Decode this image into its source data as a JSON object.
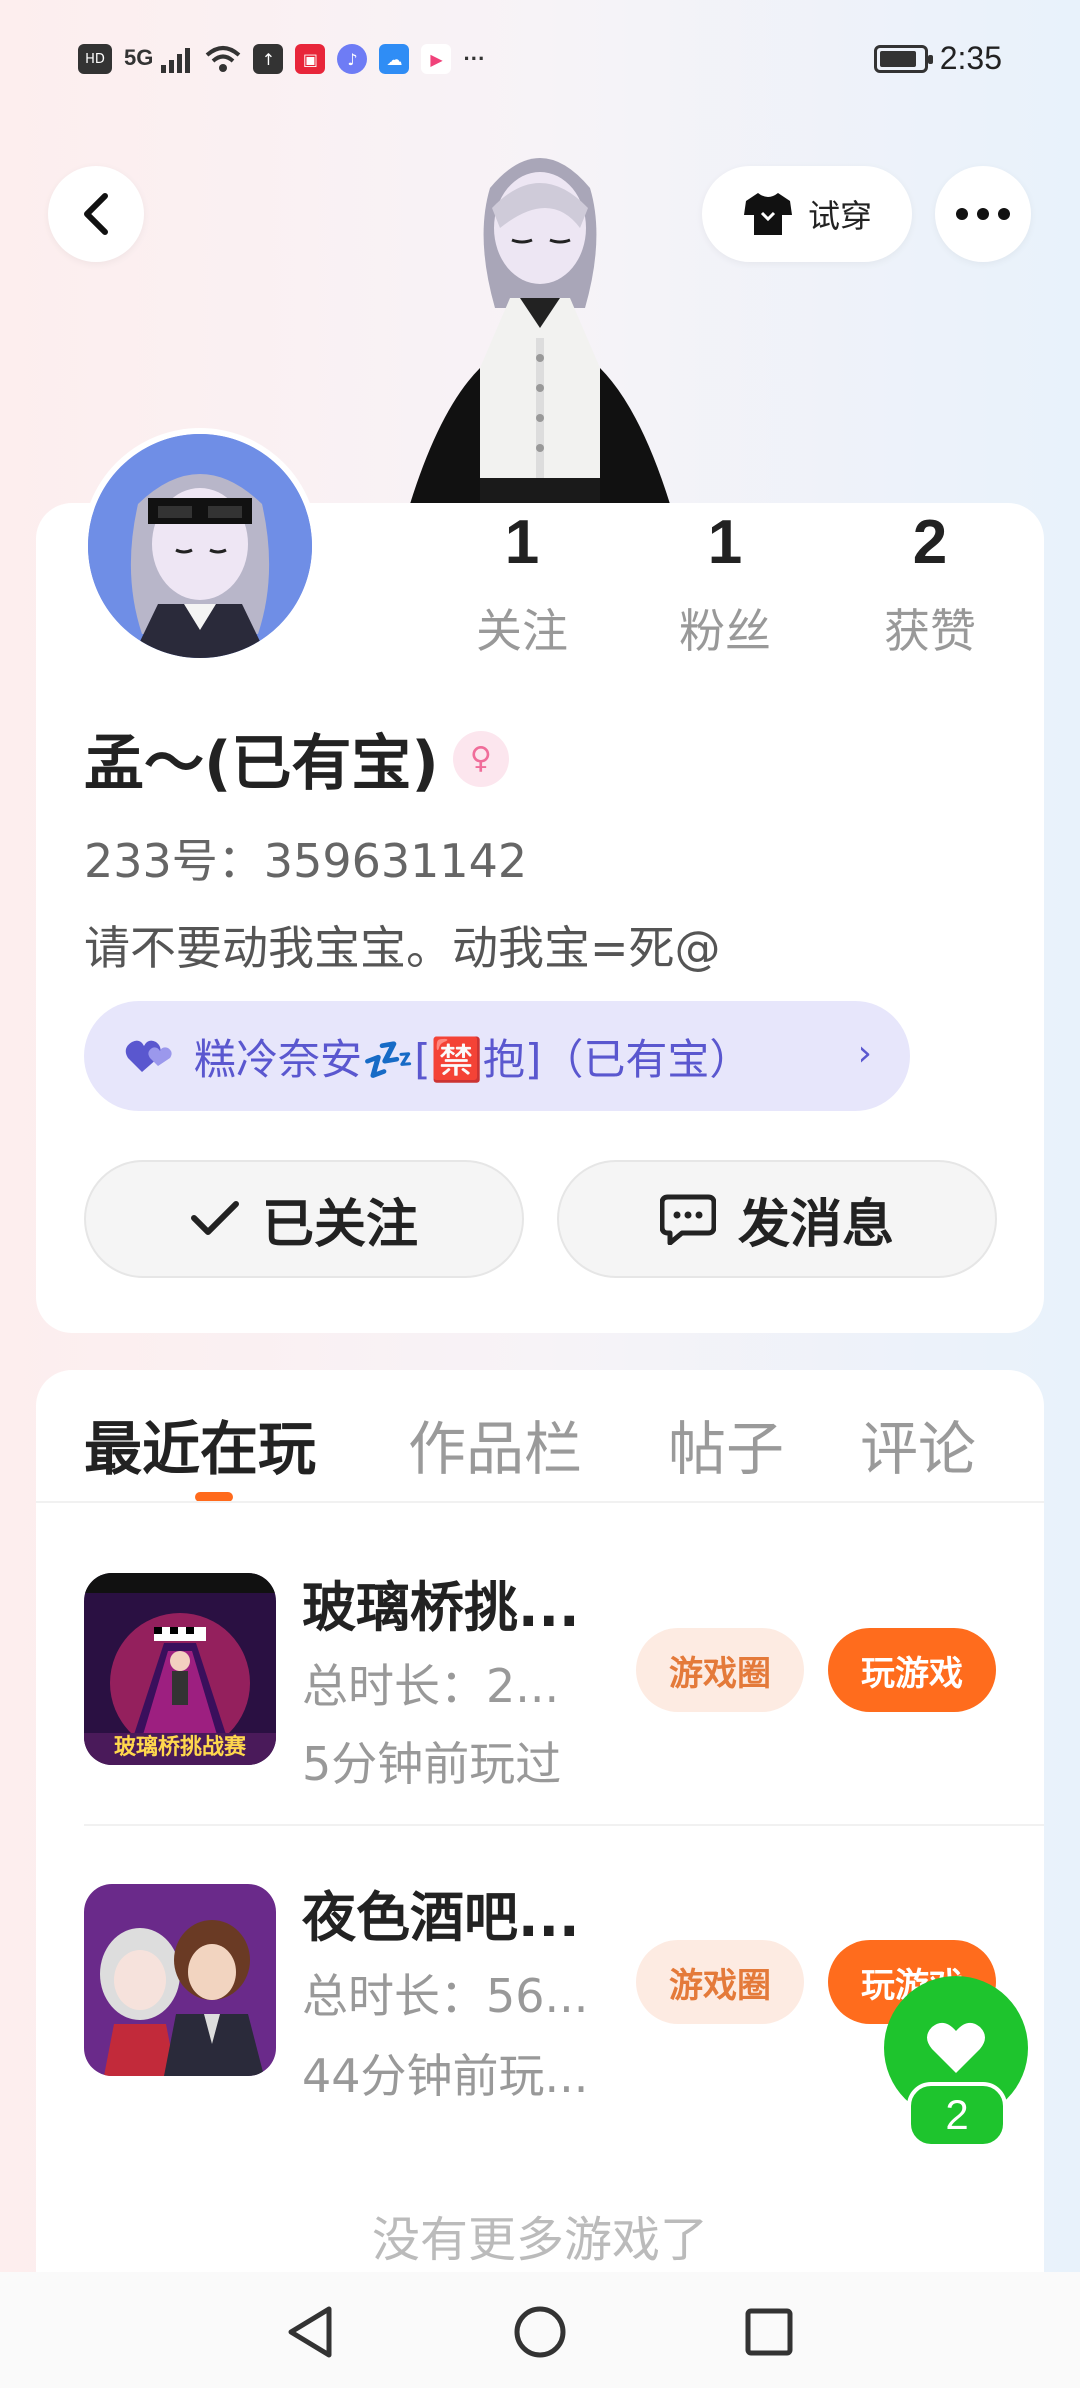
{
  "status_bar": {
    "hd_label": "HD",
    "signal_label": "5G",
    "more_label": "···",
    "time": "2:35",
    "battery_level": 0.85
  },
  "header": {
    "try_on_label": "试穿"
  },
  "profile": {
    "stats": [
      {
        "value": "1",
        "label": "关注"
      },
      {
        "value": "1",
        "label": "粉丝"
      },
      {
        "value": "2",
        "label": "获赞"
      }
    ],
    "nickname": "孟～(已有宝)",
    "gender_symbol": "♀",
    "user_id": "233号：359631142",
    "bio": "请不要动我宝宝。动我宝=死@",
    "couple": {
      "text": "糕冷奈安💤[🈲抱]（已有宝）",
      "chevron": "›"
    },
    "follow_button": "已关注",
    "message_button": "发消息"
  },
  "tabs": [
    {
      "label": "最近在玩",
      "active": true
    },
    {
      "label": "作品栏",
      "active": false
    },
    {
      "label": "帖子",
      "active": false
    },
    {
      "label": "评论",
      "active": false
    }
  ],
  "games": [
    {
      "title": "玻璃桥挑...",
      "duration": "总时长：2...",
      "last_played": "5分钟前玩过",
      "icon_caption": "玻璃桥挑战赛",
      "circle_label": "游戏圈",
      "play_label": "玩游戏"
    },
    {
      "title": "夜色酒吧...",
      "duration": "总时长：56...",
      "last_played": "44分钟前玩...",
      "circle_label": "游戏圈",
      "play_label": "玩游戏"
    }
  ],
  "no_more_text": "没有更多游戏了",
  "like_fab": {
    "count": "2"
  },
  "colors": {
    "accent_orange": "#ff6c1d",
    "couple_purple": "#5a57cf",
    "like_green": "#1ec42d"
  }
}
